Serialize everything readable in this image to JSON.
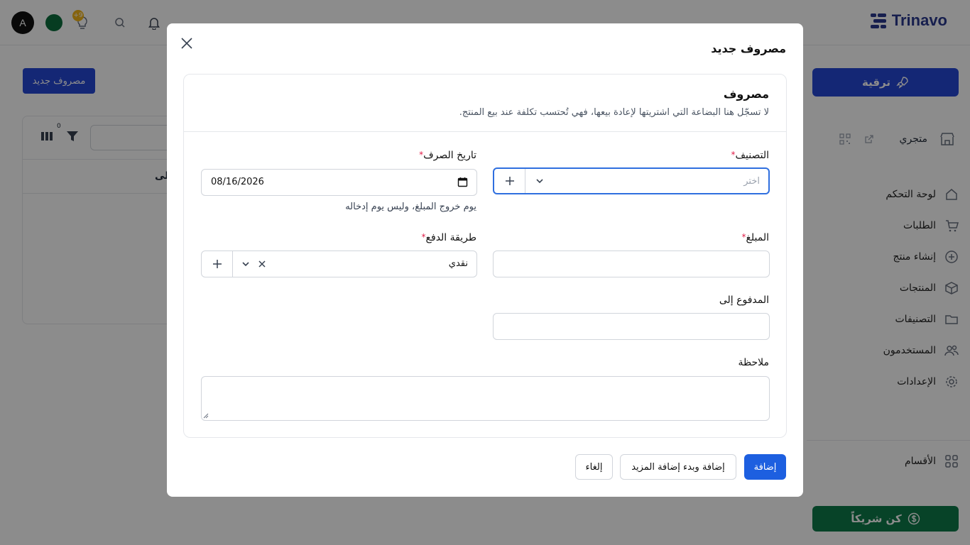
{
  "app": {
    "brand": "Trinavo",
    "avatar_initial": "A",
    "tips_badge": "+9"
  },
  "sidebar": {
    "upgrade_label": "ترقية",
    "store_label": "متجري",
    "items": [
      {
        "label": "لوحة التحكم",
        "icon": "home-icon"
      },
      {
        "label": "الطلبات",
        "icon": "cart-icon"
      },
      {
        "label": "إنشاء منتج",
        "icon": "plus-circle-icon"
      },
      {
        "label": "المنتجات",
        "icon": "box-icon"
      },
      {
        "label": "التصنيفات",
        "icon": "folder-icon"
      },
      {
        "label": "المستخدمون",
        "icon": "users-icon"
      },
      {
        "label": "الإعدادات",
        "icon": "gear-icon"
      }
    ],
    "sections_label": "الأقسام",
    "partner_label": "كن شريكاً"
  },
  "main": {
    "new_expense_button": "مصروف جديد",
    "filter_count": "0",
    "column_header": "لى"
  },
  "modal": {
    "title": "مصروف جديد",
    "card_title": "مصروف",
    "card_description": "لا تسجّل هنا البضاعة التي اشتريتها لإعادة بيعها، فهي تُحتسب تكلفة عند بيع المنتج.",
    "fields": {
      "category": {
        "label": "التصنيف",
        "required_mark": "*",
        "placeholder": "اختر"
      },
      "date": {
        "label": "تاريخ الصرف",
        "required_mark": "*",
        "value": "08/16/2026",
        "help": "يوم خروج المبلغ، وليس يوم إدخاله"
      },
      "amount": {
        "label": "المبلغ",
        "required_mark": "*",
        "value": ""
      },
      "payment_method": {
        "label": "طريقة الدفع",
        "required_mark": "*",
        "value": "نقدي"
      },
      "paid_to": {
        "label": "المدفوع إلى",
        "value": ""
      },
      "note": {
        "label": "ملاحظة",
        "value": ""
      }
    },
    "buttons": {
      "add": "إضافة",
      "add_and_more": "إضافة وبدء إضافة المزيد",
      "cancel": "إلغاء"
    }
  },
  "colors": {
    "primary": "#1d5fe0",
    "sidebar_button": "#2647d6",
    "partner_button": "#0d7a4a",
    "required": "#e11d48",
    "focus_border": "#2f6fdf"
  }
}
